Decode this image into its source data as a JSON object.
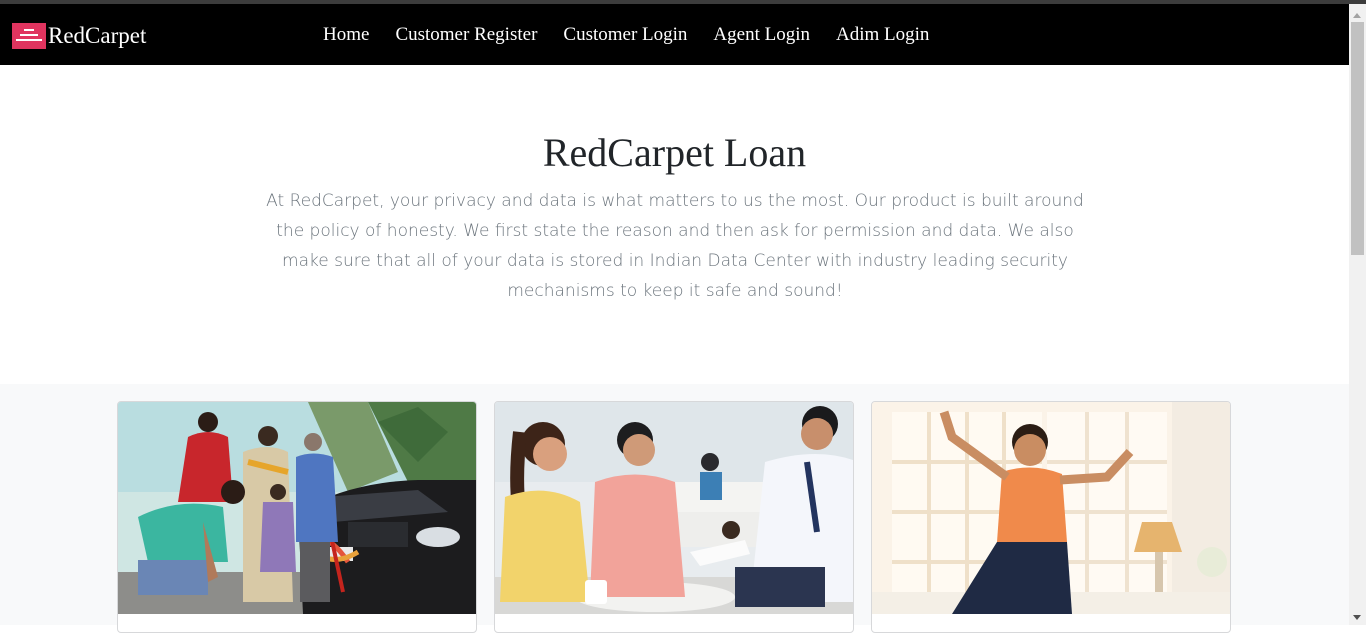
{
  "brand": {
    "name": "RedCarpet",
    "logo_color": "#e0345f"
  },
  "nav": {
    "items": [
      {
        "label": "Home"
      },
      {
        "label": "Customer Register"
      },
      {
        "label": "Customer Login"
      },
      {
        "label": "Agent Login"
      },
      {
        "label": "Adim Login"
      }
    ]
  },
  "hero": {
    "title": "RedCarpet Loan",
    "text": "At RedCarpet, your privacy and data is what matters to us the most. Our product is built around the policy of honesty. We first state the reason and then ask for permission and data. We also make sure that all of your data is stored in Indian Data Center with industry leading security mechanisms to keep it safe and sound!"
  },
  "cards": [
    {
      "image": "family-with-new-car-photo"
    },
    {
      "image": "couple-with-loan-agent-photo"
    },
    {
      "image": "happy-child-jumping-photo"
    }
  ],
  "colors": {
    "navbar": "#000000",
    "section_bg": "#f8f9fa",
    "muted_text": "#6c757d"
  }
}
